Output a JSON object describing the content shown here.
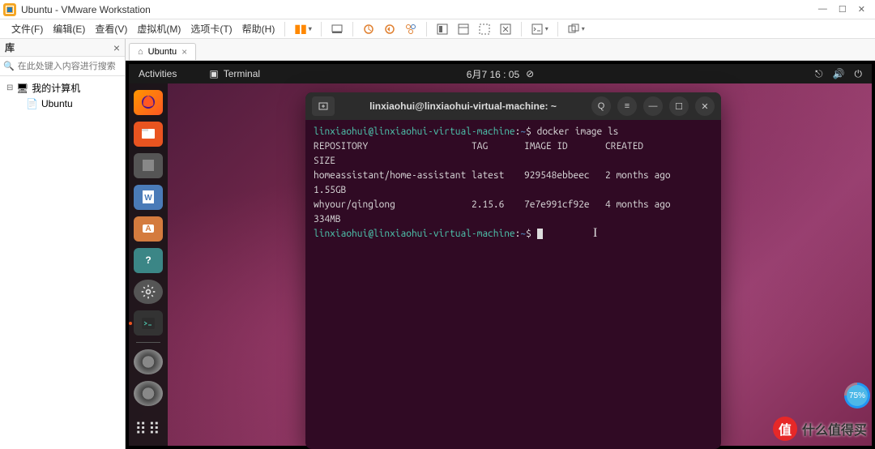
{
  "titlebar": {
    "title": "Ubuntu - VMware Workstation"
  },
  "menubar": {
    "file": "文件(F)",
    "edit": "编辑(E)",
    "view": "查看(V)",
    "vm": "虚拟机(M)",
    "tabs": "选项卡(T)",
    "help": "帮助(H)"
  },
  "sidebar": {
    "title": "库",
    "search_placeholder": "在此处键入内容进行搜索",
    "root": "我的计算机",
    "child": "Ubuntu"
  },
  "tab": {
    "label": "Ubuntu"
  },
  "ubuntu": {
    "activities": "Activities",
    "terminal_label": "Terminal",
    "datetime": "6月7 16 : 05"
  },
  "terminal": {
    "title": "linxiaohui@linxiaohui-virtual-machine: ~",
    "prompt_user": "linxiaohui@linxiaohui-virtual-machine",
    "prompt_path": "~",
    "prompt_sym": "$",
    "command": "docker image ls",
    "headers": {
      "repository": "REPOSITORY",
      "tag": "TAG",
      "image_id": "IMAGE ID",
      "created": "CREATED",
      "size": "SIZE"
    },
    "rows": [
      {
        "repository": "homeassistant/home-assistant",
        "tag": "latest",
        "image_id": "929548ebbeec",
        "created": "2 months ago",
        "size": "1.55GB"
      },
      {
        "repository": "whyour/qinglong",
        "tag": "2.15.6",
        "image_id": "7e7e991cf92e",
        "created": "4 months ago",
        "size": "334MB"
      }
    ]
  },
  "watermark": {
    "badge": "值",
    "text": "什么值得买"
  },
  "progress": "75%"
}
